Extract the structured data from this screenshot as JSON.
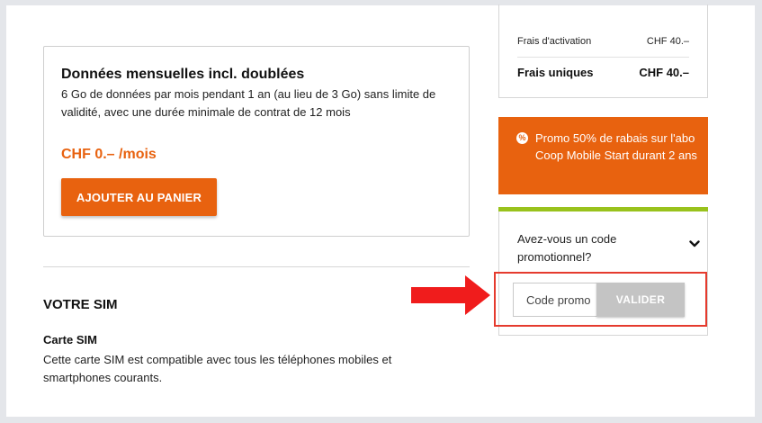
{
  "offer": {
    "title": "Données mensuelles incl. doublées",
    "description": "6 Go de données par mois pendant 1 an (au lieu de 3 Go) sans limite de validité, avec une durée minimale de contrat de 12 mois",
    "price": "CHF 0.– /mois",
    "add_to_cart_label": "AJOUTER AU PANIER"
  },
  "sim": {
    "heading": "VOTRE SIM",
    "subheading": "Carte SIM",
    "description": "Cette carte SIM est compatible avec tous les téléphones mobiles et smartphones courants."
  },
  "fees": {
    "activation_label": "Frais d'activation",
    "activation_value": "CHF 40.–",
    "one_time_label": "Frais uniques",
    "one_time_value": "CHF 40.–"
  },
  "promo": {
    "icon": "percent-badge-icon",
    "text": "Promo 50% de rabais sur l'abo Coop Mobile Start durant 2 ans"
  },
  "promo_code": {
    "question": "Avez-vous un code promotionnel?",
    "input_placeholder": "Code promo",
    "input_value": "",
    "validate_label": "VALIDER"
  },
  "colors": {
    "accent_orange": "#e8620f",
    "accent_green": "#99c21c",
    "highlight_red": "#e53b2e",
    "disabled_gray": "#c4c4c4"
  }
}
